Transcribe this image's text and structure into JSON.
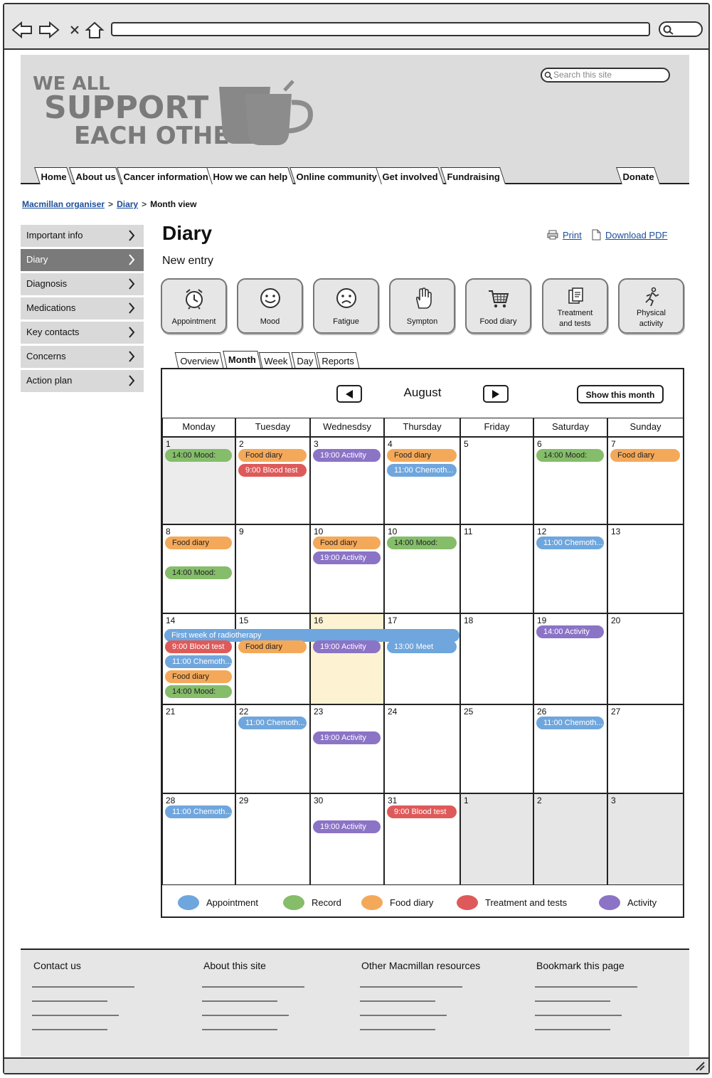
{
  "browser": {
    "back_icon": "back-arrow-icon",
    "forward_icon": "forward-arrow-icon",
    "close_icon": "close-x-icon",
    "home_icon": "home-icon"
  },
  "header": {
    "logo_text": [
      "WE ALL",
      "SUPPORT",
      "EACH OTHER"
    ],
    "search_placeholder": "Search this site",
    "nav": [
      {
        "label": "Home"
      },
      {
        "label": "About us"
      },
      {
        "label": "Cancer information"
      },
      {
        "label": "How we can help"
      },
      {
        "label": "Online community"
      },
      {
        "label": "Get involved"
      },
      {
        "label": "Fundraising"
      }
    ],
    "donate": "Donate"
  },
  "breadcrumb": {
    "items": [
      "Macmillan organiser",
      "Diary"
    ],
    "current": "Month view"
  },
  "sidebar": {
    "items": [
      {
        "label": "Important info"
      },
      {
        "label": "Diary"
      },
      {
        "label": "Diagnosis"
      },
      {
        "label": "Medications"
      },
      {
        "label": "Key contacts"
      },
      {
        "label": "Concerns"
      },
      {
        "label": "Action plan"
      }
    ],
    "active_index": 1
  },
  "main": {
    "title": "Diary",
    "subtitle": "New entry",
    "print": "Print",
    "download": "Download PDF",
    "entry_buttons": [
      {
        "label": "Appointment",
        "icon": "alarm-clock-icon"
      },
      {
        "label": "Mood",
        "icon": "smiley-face-icon"
      },
      {
        "label": "Fatigue",
        "icon": "sad-face-icon"
      },
      {
        "label": "Sympton",
        "icon": "hand-icon"
      },
      {
        "label": "Food diary",
        "icon": "shopping-cart-icon"
      },
      {
        "label": "Treatment and tests",
        "icon": "clipboard-icon"
      },
      {
        "label": "Physical activity",
        "icon": "running-person-icon"
      }
    ],
    "view_tabs": [
      "Overview",
      "Month",
      "Week",
      "Day",
      "Reports"
    ],
    "active_tab": "Month"
  },
  "calendar": {
    "month": "August",
    "show_month": "Show this month",
    "days": [
      "Monday",
      "Tuesday",
      "Wednesdsy",
      "Thursday",
      "Friday",
      "Saturday",
      "Sunday"
    ],
    "weeks": [
      [
        "1",
        "2",
        "3",
        "4",
        "5",
        "6",
        "7"
      ],
      [
        "8",
        "9",
        "10",
        "10",
        "11",
        "12",
        "13"
      ],
      [
        "14",
        "15",
        "16",
        "17",
        "18",
        "19",
        "20"
      ],
      [
        "21",
        "22",
        "23",
        "24",
        "25",
        "26",
        "27"
      ],
      [
        "28",
        "29",
        "30",
        "31",
        "1",
        "2",
        "3"
      ]
    ],
    "events": [
      {
        "week": 0,
        "day": 0,
        "slot": 0,
        "type": "record",
        "text": "14:00 Mood:"
      },
      {
        "week": 0,
        "day": 1,
        "slot": 0,
        "type": "food",
        "text": "Food diary"
      },
      {
        "week": 0,
        "day": 1,
        "slot": 1,
        "type": "treatment",
        "text": "9:00 Blood test"
      },
      {
        "week": 0,
        "day": 2,
        "slot": 0,
        "type": "activity",
        "text": "19:00 Activity"
      },
      {
        "week": 0,
        "day": 3,
        "slot": 0,
        "type": "food",
        "text": "Food diary"
      },
      {
        "week": 0,
        "day": 3,
        "slot": 1,
        "type": "appointment",
        "text": "11:00 Chemoth..."
      },
      {
        "week": 0,
        "day": 5,
        "slot": 0,
        "type": "record",
        "text": "14:00 Mood:"
      },
      {
        "week": 0,
        "day": 6,
        "slot": 0,
        "type": "food",
        "text": "Food diary"
      },
      {
        "week": 1,
        "day": 0,
        "slot": 0,
        "type": "food",
        "text": "Food diary"
      },
      {
        "week": 1,
        "day": 0,
        "slot": 2,
        "type": "record",
        "text": "14:00 Mood:"
      },
      {
        "week": 1,
        "day": 2,
        "slot": 0,
        "type": "food",
        "text": "Food diary"
      },
      {
        "week": 1,
        "day": 2,
        "slot": 1,
        "type": "activity",
        "text": "19:00 Activity"
      },
      {
        "week": 1,
        "day": 3,
        "slot": 0,
        "type": "record",
        "text": "14:00 Mood:"
      },
      {
        "week": 1,
        "day": 5,
        "slot": 0,
        "type": "appointment",
        "text": "11:00 Chemoth..."
      },
      {
        "week": 2,
        "day": 0,
        "slot": 1,
        "type": "treatment",
        "text": "9:00 Blood test"
      },
      {
        "week": 2,
        "day": 0,
        "slot": 2,
        "type": "appointment",
        "text": "11:00 Chemoth..."
      },
      {
        "week": 2,
        "day": 0,
        "slot": 3,
        "type": "food",
        "text": "Food diary"
      },
      {
        "week": 2,
        "day": 0,
        "slot": 4,
        "type": "record",
        "text": "14:00 Mood:"
      },
      {
        "week": 2,
        "day": 1,
        "slot": 1,
        "type": "food",
        "text": "Food diary"
      },
      {
        "week": 2,
        "day": 2,
        "slot": 1,
        "type": "activity",
        "text": "19:00 Activity"
      },
      {
        "week": 2,
        "day": 3,
        "slot": 1,
        "type": "appointment",
        "text": "13:00 Meet"
      },
      {
        "week": 2,
        "day": 5,
        "slot": 0,
        "type": "activity",
        "text": "14:00 Activity"
      },
      {
        "week": 3,
        "day": 1,
        "slot": 0,
        "type": "appointment",
        "text": "11:00 Chemoth..."
      },
      {
        "week": 3,
        "day": 2,
        "slot": 1,
        "type": "activity",
        "text": "19:00 Activity"
      },
      {
        "week": 3,
        "day": 5,
        "slot": 0,
        "type": "appointment",
        "text": "11:00 Chemoth..."
      },
      {
        "week": 4,
        "day": 0,
        "slot": 0,
        "type": "appointment",
        "text": "11:00 Chemoth..."
      },
      {
        "week": 4,
        "day": 2,
        "slot": 1,
        "type": "activity",
        "text": "19:00 Activity"
      },
      {
        "week": 4,
        "day": 3,
        "slot": 0,
        "type": "treatment",
        "text": "9:00 Blood test"
      }
    ],
    "span_event": {
      "text": "First week of radiotherapy",
      "type": "appointment",
      "week": 2,
      "from_day": 0,
      "to_day": 3
    },
    "legend": [
      {
        "label": "Appointment",
        "color": "#6fa6dd"
      },
      {
        "label": "Record",
        "color": "#85bd6a"
      },
      {
        "label": "Food diary",
        "color": "#f4a95a"
      },
      {
        "label": "Treatment and tests",
        "color": "#de5a5a"
      },
      {
        "label": "Activity",
        "color": "#8b73c6"
      }
    ]
  },
  "colors": {
    "appointment": "#6fa6dd",
    "record": "#85bd6a",
    "food": "#f4a95a",
    "treatment": "#de5a5a",
    "activity": "#8b73c6",
    "link": "#1a4d99"
  },
  "footer": {
    "columns": [
      {
        "title": "Contact us"
      },
      {
        "title": "About this site"
      },
      {
        "title": "Other Macmillan resources"
      },
      {
        "title": "Bookmark this page"
      }
    ]
  }
}
